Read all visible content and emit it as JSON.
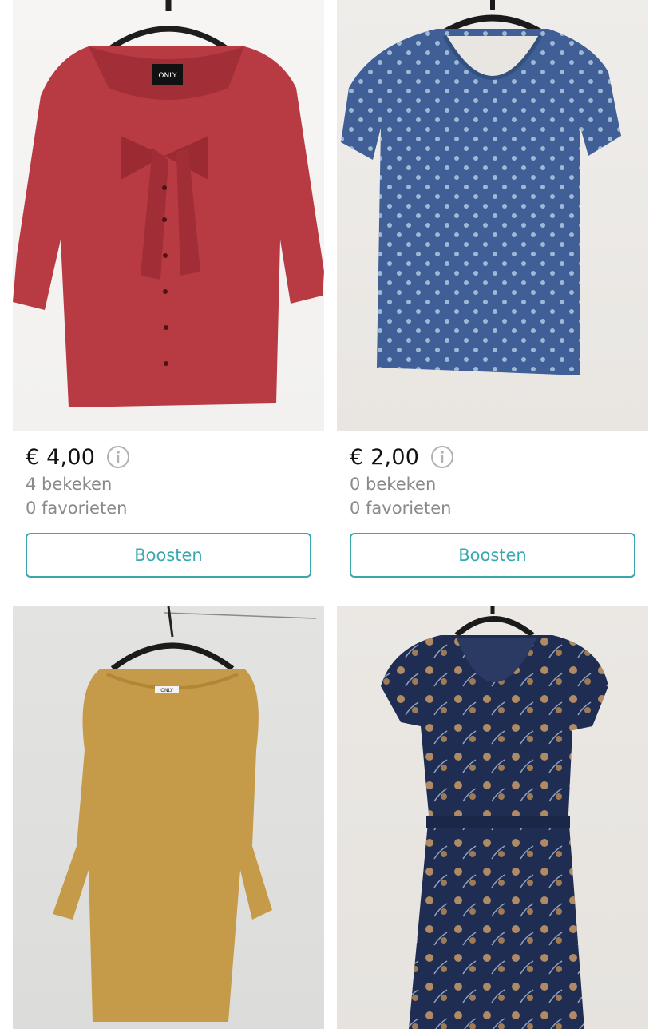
{
  "listings": [
    {
      "price": "€ 4,00",
      "views": "4 bekeken",
      "favorites": "0 favorieten",
      "boost_label": "Boosten",
      "tag": "ONLY",
      "item_color": "#b83a42"
    },
    {
      "price": "€ 2,00",
      "views": "0 bekeken",
      "favorites": "0 favorieten",
      "boost_label": "Boosten",
      "item_color": "#3f5f96"
    },
    {
      "tag": "ONLY",
      "item_color": "#c59a48"
    },
    {
      "item_color": "#1f2d52"
    }
  ],
  "accent_color": "#3aa7ae",
  "icons": {
    "info": "info-circle-icon"
  }
}
